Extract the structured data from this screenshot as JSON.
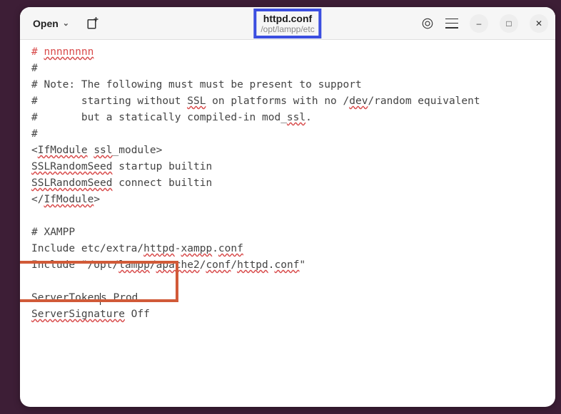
{
  "header": {
    "open_label": "Open",
    "filename": "httpd.conf",
    "filepath": "/opt/lampp/etc",
    "minimize": "–",
    "maximize": "□",
    "close": "✕"
  },
  "editor": {
    "truncated_marker_prefix": "# ",
    "l1": "#",
    "l2a": "# Note: The following must must be present to support",
    "l3a": "#       starting without ",
    "l3b": "SSL",
    "l3c": " on platforms with no /",
    "l3d": "dev",
    "l3e": "/random equivalent",
    "l4a": "#       but a statically compiled-in mod_",
    "l4b": "ssl",
    "l4c": ".",
    "l5": "#",
    "l6a": "<",
    "l6b": "IfModule",
    "l6c": " ",
    "l6d": "ssl",
    "l6e": "_module>",
    "l7a": "SSLRandomSeed",
    "l7b": " startup builtin",
    "l8a": "SSLRandomSeed",
    "l8b": " connect builtin",
    "l9a": "</",
    "l9b": "IfModule",
    "l9c": ">",
    "l10": "",
    "l11": "# XAMPP",
    "l12a": "Include etc/extra/",
    "l12b": "httpd",
    "l12c": "-",
    "l12d": "xampp",
    "l12e": ".",
    "l12f": "conf",
    "l13a": "Include \"/opt/",
    "l13b": "lampp",
    "l13c": "/",
    "l13d": "apache2",
    "l13e": "/",
    "l13f": "conf",
    "l13g": "/",
    "l13h": "httpd",
    "l13i": ".",
    "l13j": "conf",
    "l13k": "\"",
    "l14": "",
    "l15a": "ServerToken",
    "l15b": "s Prod",
    "l16a": "ServerSignature",
    "l16b": " Off"
  }
}
